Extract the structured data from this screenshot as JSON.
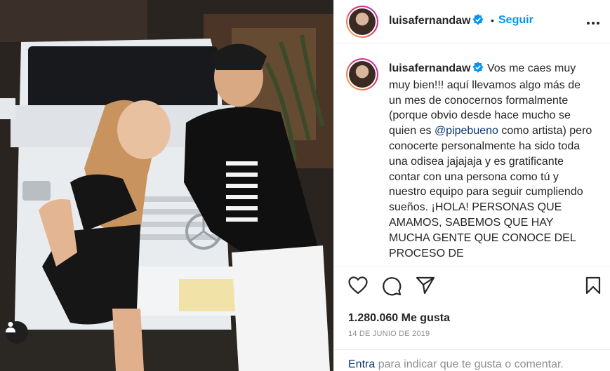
{
  "post": {
    "username": "luisafernandaw",
    "separator": "•",
    "follow_label": "Seguir",
    "more_label": "•••"
  },
  "caption": {
    "username": "luisafernandaw",
    "text_before": "Vos me caes muy muy bien!!! aquí llevamos algo más de un mes de conocernos formalmente (porque obvio desde hace mucho se quien es ",
    "mention": "@pipebueno",
    "text_after": " como artista) pero conocerte personalmente ha sido toda una odisea jajajaja y es gratificante contar con una persona como tú y nuestro equipo para seguir cumpliendo sueños. ¡HOLA! PERSONAS QUE AMAMOS, SABEMOS QUE HAY MUCHA GENTE QUE CONOCE DEL PROCESO DE"
  },
  "stats": {
    "likes": "1.280.060 Me gusta",
    "date": "14 DE JUNIO DE 2019"
  },
  "comment": {
    "link_label": "Entra",
    "rest": " para indicar que te gusta o comentar."
  },
  "icons": {
    "like": "heart-icon",
    "comment": "comment-icon",
    "share": "share-icon",
    "save": "bookmark-icon",
    "tag": "user-tag-icon",
    "verified": "verified-badge-icon"
  },
  "colors": {
    "accent": "#0095f6",
    "verified": "#0095f6",
    "mention": "#0a3670",
    "muted": "#8e8e8e"
  }
}
